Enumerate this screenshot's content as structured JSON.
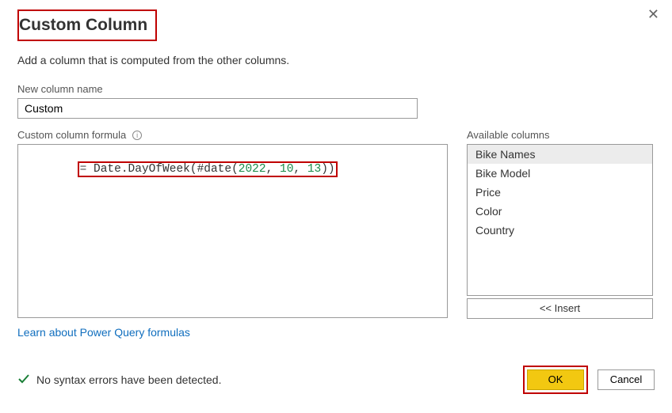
{
  "dialog": {
    "title": "Custom Column",
    "subtitle": "Add a column that is computed from the other columns."
  },
  "nameField": {
    "label": "New column name",
    "value": "Custom"
  },
  "formulaField": {
    "label": "Custom column formula",
    "prefix": "= ",
    "fn1": "Date.DayOfWeek",
    "open1": "(",
    "hash": "#date",
    "open2": "(",
    "n1": "2022",
    "sep1": ", ",
    "n2": "10",
    "sep2": ", ",
    "n3": "13",
    "close2": ")",
    "close1": ")"
  },
  "available": {
    "label": "Available columns",
    "items": [
      "Bike Names",
      "Bike Model",
      "Price",
      "Color",
      "Country"
    ],
    "insert": "<< Insert"
  },
  "link": {
    "text": "Learn about Power Query formulas"
  },
  "status": {
    "text": "No syntax errors have been detected."
  },
  "buttons": {
    "ok": "OK",
    "cancel": "Cancel"
  }
}
